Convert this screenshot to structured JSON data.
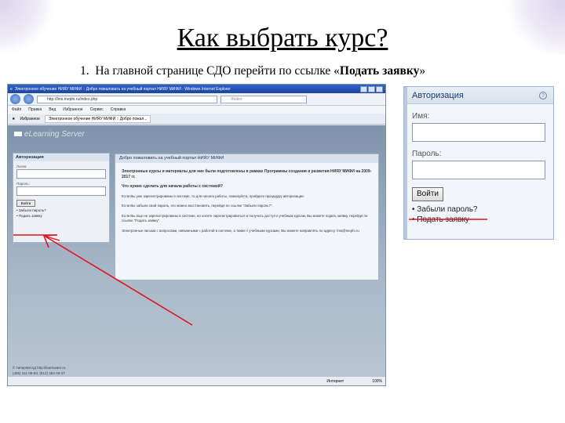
{
  "slide": {
    "title": "Как выбрать курс?",
    "step_number": "1.",
    "step_text_prefix": "На главной странице СДО перейти по ссылке «",
    "step_text_bold": "Подать заявку",
    "step_text_suffix": "»"
  },
  "browser": {
    "window_title": "Электронное обучение НИЯУ МИФИ :: Добро пожаловать на учебный портал НИЯУ МИФИ - Windows Internet Explorer",
    "address": "http://lms.mephi.ru/index.php",
    "search_placeholder": "Яndex",
    "menu": [
      "Файл",
      "Правка",
      "Вид",
      "Избранное",
      "Сервис",
      "Справка"
    ],
    "favorites_label": "Избранное",
    "tab_label": "Электронное обучение НИЯУ МИФИ :: Добро пожал...",
    "logo_text": "eLearning Server",
    "auth": {
      "title": "Авторизация",
      "login_label": "Логин:",
      "password_label": "Пароль:",
      "submit_label": "Войти",
      "forgot_link": "• Забыли пароль?",
      "apply_link": "• Подать заявку"
    },
    "welcome": {
      "title": "Добро пожаловать на учебный портал НИЯУ МИФИ",
      "heading": "Электронные курсы и материалы для них были подготовлены в рамках Программы создания и развития НИЯУ МИФИ на 2009-2017 гг.",
      "question": "Что нужно сделать для начала работы с системой?",
      "para1": "Если Вы уже зарегистрированы в системе, то для начала работы, пожалуйста, пройдите процедуру авторизации.",
      "para2": "Если Вы забыли свой пароль, его можно восстановить, перейдя по ссылке \"Забыли пароль?\".",
      "para3": "Если Вы еще не зарегистрированы в системе, но хотите зарегистрироваться и получить доступ к учебным курсам, Вы можете подать заявку, перейдя по ссылке \"Подать заявку\".",
      "para4": "Электронные письма с вопросами, связанными с работой в системе, а также с учебными курсами, Вы можете направлять по адресу: lms@mephi.ru"
    },
    "footer_line1": "© ГиперМетод http://learnware.ru",
    "footer_line2": "(495) 411-09-53, (812) 363-49-27",
    "status_zone": "Интернет",
    "status_zoom": "100%"
  },
  "inset": {
    "title": "Авторизация",
    "login_label": "Имя:",
    "password_label": "Пароль:",
    "submit_label": "Войти",
    "forgot_link": "• Забыли пароль?",
    "apply_link": "• Подать заявку"
  },
  "colors": {
    "annotation_red": "#e0141c",
    "panel_header": "#1f3b6b"
  }
}
